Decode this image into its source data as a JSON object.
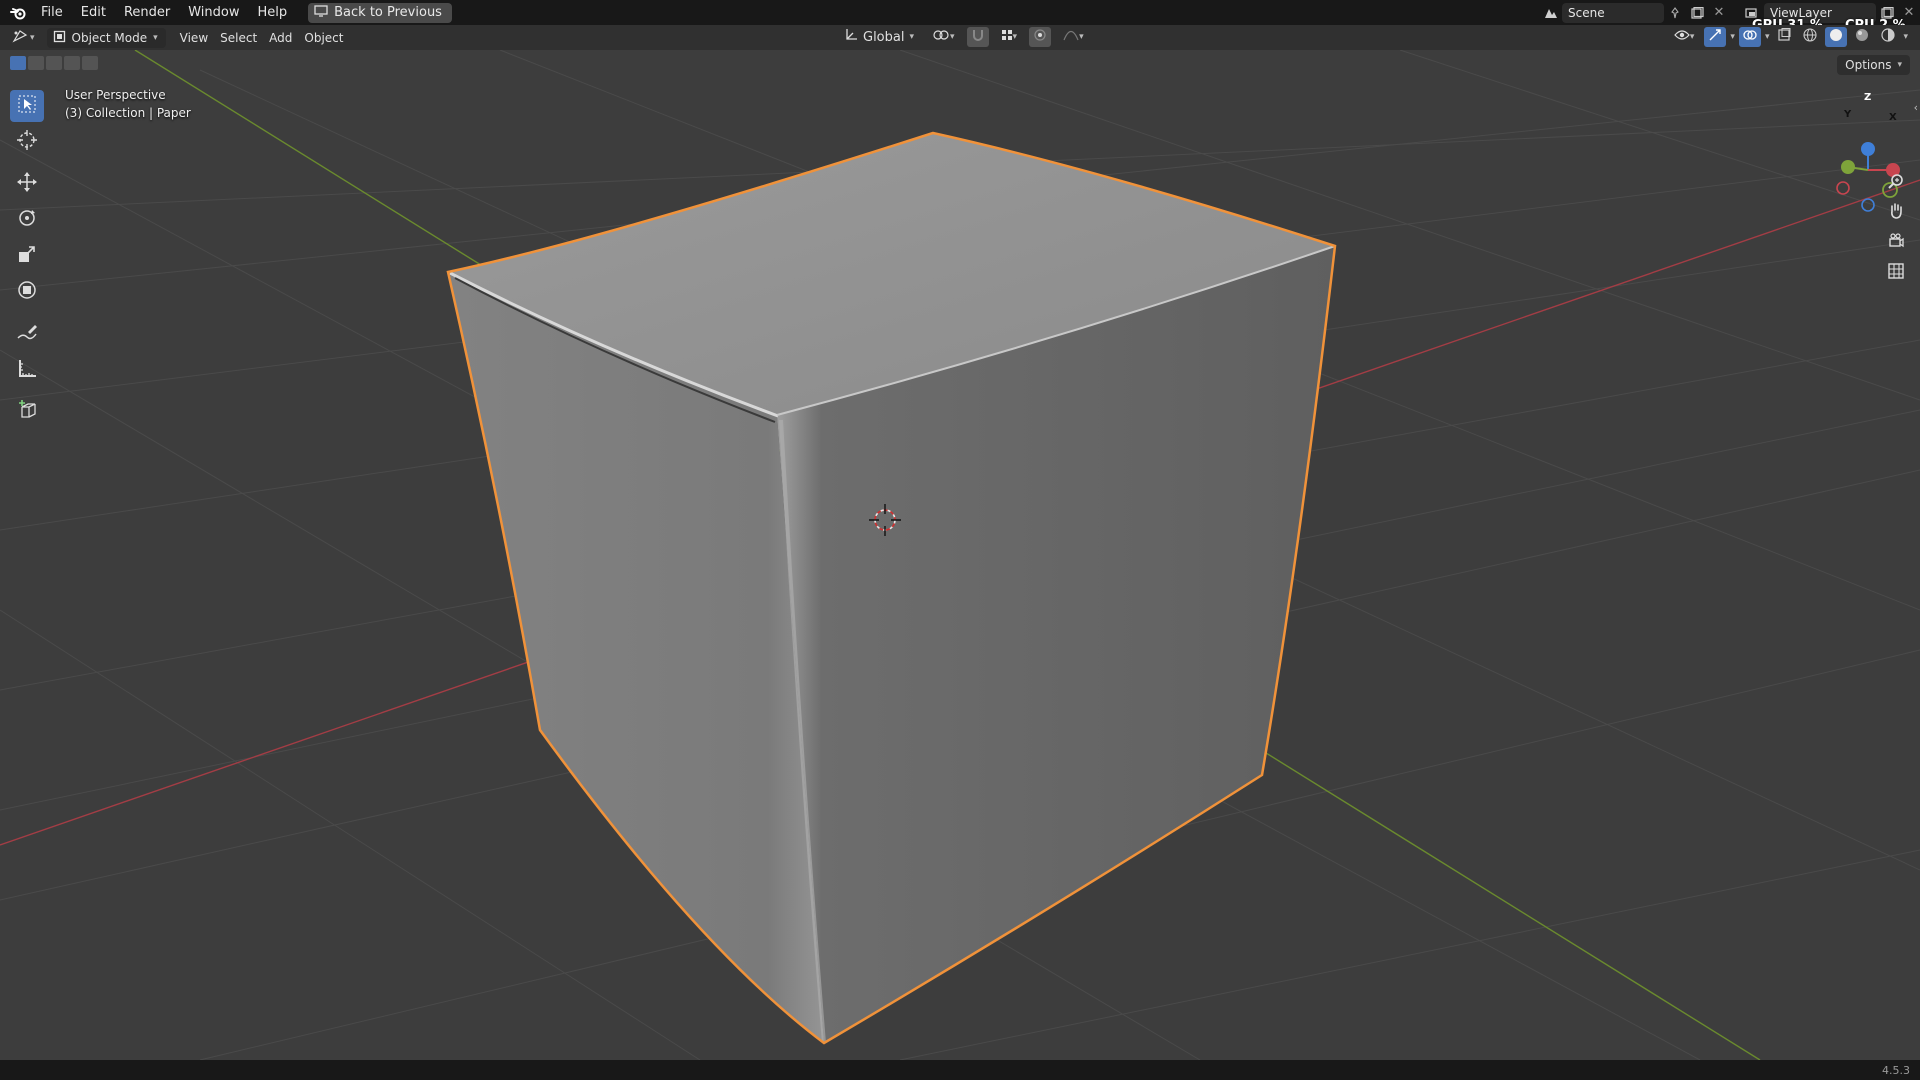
{
  "topbar": {
    "menus": [
      "File",
      "Edit",
      "Render",
      "Window",
      "Help"
    ],
    "back_label": "Back to Previous",
    "scene": "Scene",
    "view_layer": "ViewLayer",
    "gpu": "GPU 31 %",
    "cpu": "CPU  2 %"
  },
  "header": {
    "mode": "Object Mode",
    "menus": [
      "View",
      "Select",
      "Add",
      "Object"
    ],
    "transform_orientation": "Global",
    "options": "Options"
  },
  "viewport": {
    "perspective": "User Perspective",
    "collection": "(3) Collection | Paper",
    "gizmo_axes": [
      "Z",
      "Y",
      "X"
    ]
  },
  "status": {
    "version": "4.5.3"
  },
  "colors": {
    "accent": "#4772b3",
    "selection_outline": "#f0923a",
    "x_axis": "#c8454f",
    "y_axis": "#7ea33a",
    "z_axis": "#3f7fd8"
  }
}
